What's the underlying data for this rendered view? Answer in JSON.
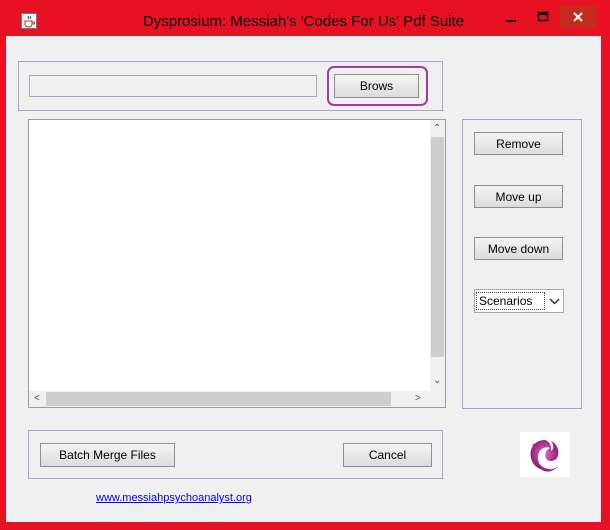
{
  "window": {
    "title": "Dysprosium: Messiah's 'Codes For Us' Pdf Suite",
    "app_icon": "java-cup-icon",
    "controls": [
      "minimize-icon",
      "maximize-icon",
      "close-icon"
    ]
  },
  "file_bar": {
    "path_value": "",
    "browse_label": "Brows"
  },
  "side_panel": {
    "remove_label": "Remove",
    "move_up_label": "Move up",
    "move_down_label": "Move down",
    "scenario_selected": "Scenarios"
  },
  "bottom_bar": {
    "merge_label": "Batch Merge Files",
    "cancel_label": "Cancel"
  },
  "footer": {
    "link_text": "www.messiahpsychoanalyst.org"
  },
  "colors": {
    "title_bar": "#e81123",
    "close_button": "#c42b1c",
    "panel_border": "#a7a2c7",
    "highlight_ring": "#9c3d9f",
    "logo_magenta": "#9b1b7e",
    "link": "#0000ee"
  }
}
